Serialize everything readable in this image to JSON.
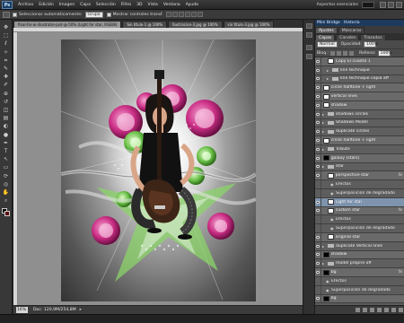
{
  "menubar": {
    "logo": "Ps",
    "items": [
      "Archivo",
      "Edición",
      "Imagen",
      "Capa",
      "Selección",
      "Filtro",
      "3D",
      "Vista",
      "Ventana",
      "Ayuda"
    ],
    "workspace": "Aspectos esenciales"
  },
  "options": {
    "auto_select_label": "Seleccionar automáticamente:",
    "auto_select_value": "Grupo",
    "show_transform_label": "Mostrar controles transf."
  },
  "document": {
    "tabs": [
      "final-for-ai-illustrator-psd-@-50% (Light for star, RGB/8)",
      "Sin título-1 @ 100%",
      "Ilustracion-3.jpg @ 100%",
      "sin título-3.jpg @ 100%"
    ],
    "zoom": "16%",
    "doc_info": "Doc: 120,9M/254,8M"
  },
  "panels": {
    "top_tabs": [
      "Mini Bridge",
      "Historia"
    ],
    "mid_tabs": [
      "Ajustes",
      "Máscaras"
    ],
    "layer_tabs": [
      "Capas",
      "Canales",
      "Trazados"
    ],
    "blend_mode": "Normal",
    "opacity_label": "Opacidad:",
    "opacity_value": "100%",
    "lock_label": "Bloq.:",
    "fill_label": "Relleno:",
    "fill_value": "100%"
  },
  "layers": [
    {
      "name": "Copy El cuadro 1",
      "type": "thumb",
      "thumb": "white",
      "indent": 1
    },
    {
      "name": "line technique",
      "type": "group",
      "indent": 1
    },
    {
      "name": "line technique copia aff",
      "type": "group",
      "indent": 1
    },
    {
      "name": "circle halftone + light",
      "type": "thumb",
      "thumb": "white",
      "indent": 0
    },
    {
      "name": "vertical lines",
      "type": "thumb",
      "thumb": "white",
      "indent": 0
    },
    {
      "name": "shadow",
      "type": "thumb",
      "thumb": "white",
      "indent": 0
    },
    {
      "name": "shadows circles",
      "type": "group",
      "indent": 0
    },
    {
      "name": "Shadows Model",
      "type": "group",
      "indent": 0
    },
    {
      "name": "duplicate circles",
      "type": "group",
      "indent": 0
    },
    {
      "name": "circle halftone + light",
      "type": "thumb",
      "thumb": "white",
      "indent": 0
    },
    {
      "name": "Tribute",
      "type": "group",
      "indent": 0
    },
    {
      "name": "galaxy (stars)",
      "type": "thumb",
      "thumb": "black",
      "indent": 0
    },
    {
      "name": "star",
      "type": "group",
      "indent": 0
    },
    {
      "name": "perspective star",
      "type": "thumb",
      "thumb": "white",
      "indent": 1,
      "fx": true
    },
    {
      "name": "Efectos",
      "type": "effect",
      "indent": 2
    },
    {
      "name": "Superposición de degradado",
      "type": "effect",
      "indent": 2
    },
    {
      "name": "Light for star",
      "type": "thumb",
      "thumb": "white",
      "indent": 1,
      "selected": true
    },
    {
      "name": "custom star",
      "type": "thumb",
      "thumb": "white",
      "indent": 1,
      "fx": true
    },
    {
      "name": "Efectos",
      "type": "effect",
      "indent": 2
    },
    {
      "name": "Superposición de degradado",
      "type": "effect",
      "indent": 2
    },
    {
      "name": "original star",
      "type": "thumb",
      "thumb": "white",
      "indent": 1
    },
    {
      "name": "duplicate Vertical lines",
      "type": "group",
      "indent": 0
    },
    {
      "name": "shadow",
      "type": "thumb",
      "thumb": "black",
      "indent": 0
    },
    {
      "name": "model proprie off",
      "type": "group",
      "indent": 0
    },
    {
      "name": "bg",
      "type": "thumb",
      "thumb": "black",
      "indent": 0,
      "fx": true
    },
    {
      "name": "Efectos",
      "type": "effect",
      "indent": 1
    },
    {
      "name": "Superposición de degradado",
      "type": "effect",
      "indent": 1
    },
    {
      "name": "bg",
      "type": "thumb",
      "thumb": "black",
      "indent": 0
    }
  ],
  "colors": {
    "selection": "#7e93ad",
    "pink": "#cc2f86",
    "green": "#6cc24a",
    "foreground": "#000000",
    "background": "#5c0b0b"
  },
  "icons": {
    "tools": [
      "move-icon",
      "marquee-icon",
      "lasso-icon",
      "magic-wand-icon",
      "crop-icon",
      "eyedropper-icon",
      "healing-icon",
      "brush-icon",
      "stamp-icon",
      "history-brush-icon",
      "eraser-icon",
      "gradient-icon",
      "blur-icon",
      "dodge-icon",
      "pen-icon",
      "type-icon",
      "path-select-icon",
      "shape-icon",
      "3d-rotate-icon",
      "3d-orbit-icon",
      "hand-icon",
      "zoom-icon"
    ]
  }
}
